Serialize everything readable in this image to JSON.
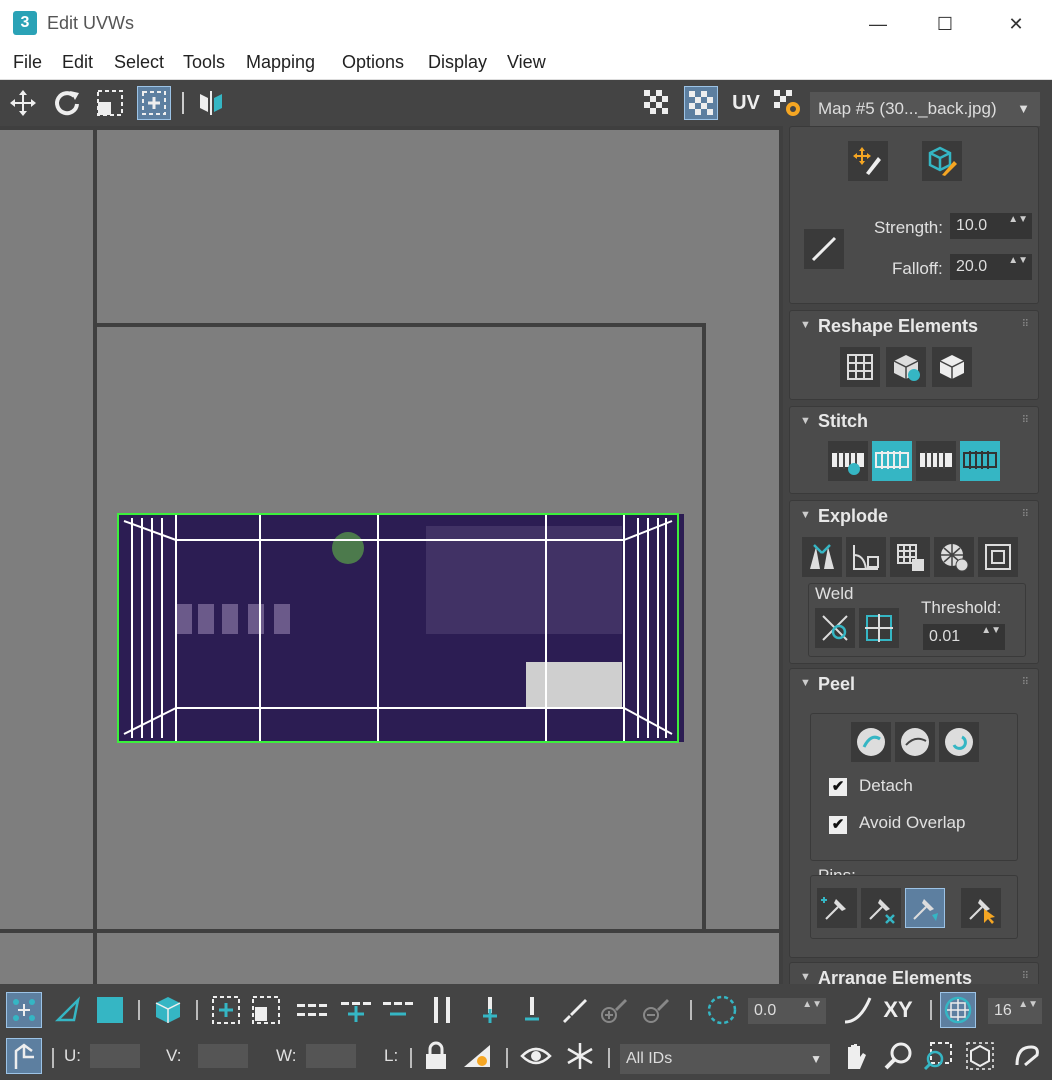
{
  "window": {
    "app_icon": "3",
    "title": "Edit UVWs",
    "minimize": "—",
    "maximize": "☐",
    "close": "✕"
  },
  "menu": [
    "File",
    "Edit",
    "Select",
    "Tools",
    "Mapping",
    "Options",
    "Display",
    "View"
  ],
  "toolbar": {
    "uv_label": "UV",
    "map_select": "Map #5 (30..._back.jpg)",
    "dropdown": "▼"
  },
  "panel": {
    "strength_label": "Strength:",
    "strength_value": "10.0",
    "falloff_label": "Falloff:",
    "falloff_value": "20.0",
    "reshape_title": "Reshape Elements",
    "stitch_title": "Stitch",
    "explode_title": "Explode",
    "weld_label": "Weld",
    "threshold_label": "Threshold:",
    "threshold_value": "0.01",
    "peel_title": "Peel",
    "detach_label": "Detach",
    "detach_checked": true,
    "avoid_overlap_label": "Avoid Overlap",
    "avoid_overlap_checked": true,
    "pins_label": "Pins:",
    "arrange_title": "Arrange Elements",
    "caret": "▼",
    "grip": "⠿",
    "spin_arrows": "▲▼",
    "check": "✔"
  },
  "bottom": {
    "angle_value": "0.0",
    "xy_label": "XY",
    "grid_value": "16",
    "u_label": "U:",
    "v_label": "V:",
    "w_label": "W:",
    "l_label": "L:",
    "ids_select": "All IDs"
  },
  "colors": {
    "accent": "#35b6c4",
    "toolbar": "#444444",
    "canvas": "#7e7e7e",
    "uv_wire": "#ffffff",
    "uv_border": "#3cf03c",
    "label_purple": "#2c1d53"
  }
}
